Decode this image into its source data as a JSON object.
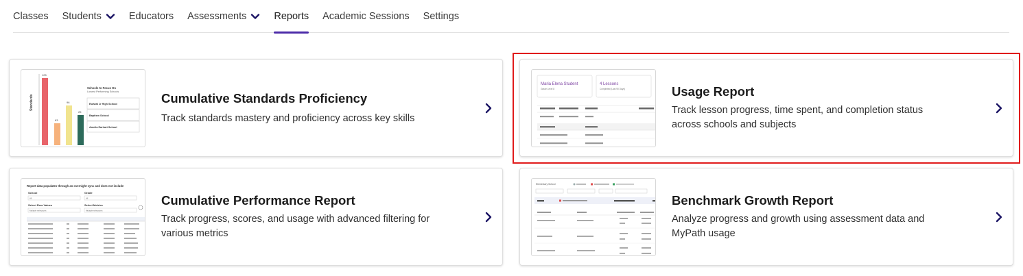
{
  "nav": {
    "items": [
      {
        "label": "Classes",
        "dropdown": false,
        "active": false
      },
      {
        "label": "Students",
        "dropdown": true,
        "active": false
      },
      {
        "label": "Educators",
        "dropdown": false,
        "active": false
      },
      {
        "label": "Assessments",
        "dropdown": true,
        "active": false
      },
      {
        "label": "Reports",
        "dropdown": false,
        "active": true
      },
      {
        "label": "Academic Sessions",
        "dropdown": false,
        "active": false
      },
      {
        "label": "Settings",
        "dropdown": false,
        "active": false
      }
    ],
    "accent_color": "#4b2aa8"
  },
  "cards": [
    {
      "title": "Cumulative Standards Proficiency",
      "description": "Track standards mastery and proficiency across key skills",
      "thumb": {
        "bar_values": [
          "125",
          "63",
          "96",
          "25"
        ],
        "axis_label": "Standards",
        "heading1": "Schools to Focus On",
        "heading2": "Lowest Performing Schools",
        "schools": [
          "Ewiwat Jr High School",
          "Baptism School",
          "Amelia Earhart School"
        ]
      }
    },
    {
      "title": "Usage Report",
      "description": "Track lesson progress, time spent, and completion status across schools and subjects",
      "highlighted": true,
      "thumb": {
        "student_name": "Maria Elena Student",
        "student_sub": "Grade Level 8",
        "lessons": "4 Lessons",
        "lessons_sub": "Completed (Last 90 Days)"
      }
    },
    {
      "title": "Cumulative Performance Report",
      "description": "Track progress, scores, and usage with advanced filtering for various metrics",
      "thumb": {
        "banner": "Report data populates through an overnight sync and does not include",
        "school_label": "School",
        "grade_label": "Grade",
        "all": "All",
        "values_label": "Select Row Values",
        "metrics_label": "Select Metrics",
        "multiple": "Multiple selections"
      }
    },
    {
      "title": "Benchmark Growth Report",
      "description": "Analyze progress and growth using assessment data and MyPath usage",
      "thumb": {
        "label": "Elementary School"
      }
    }
  ],
  "highlight_color": "#e01a1a"
}
